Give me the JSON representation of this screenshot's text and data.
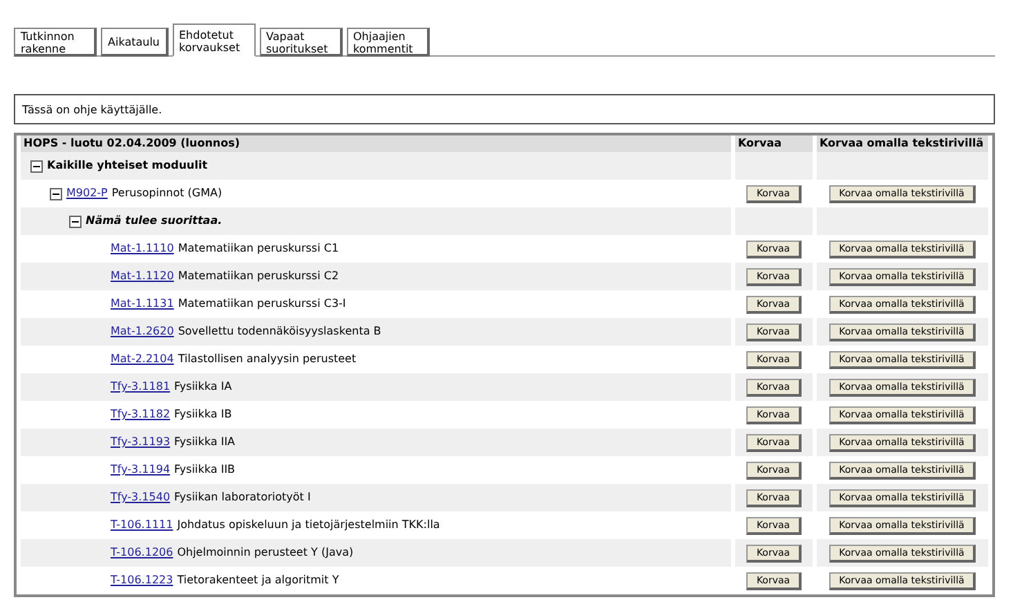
{
  "tabs": [
    {
      "label": "Tutkinnon rakenne",
      "selected": false
    },
    {
      "label": "Aikataulu",
      "selected": false
    },
    {
      "label": "Ehdotetut korvaukset",
      "selected": true
    },
    {
      "label": "Vapaat suoritukset",
      "selected": false
    },
    {
      "label": "Ohjaajien kommentit",
      "selected": false
    }
  ],
  "instructions": "Tässä on ohje käyttäjälle.",
  "table": {
    "columns": [
      "HOPS - luotu 02.04.2009 (luonnos)",
      "Korvaa",
      "Korvaa omalla tekstirivillä"
    ],
    "tree": [
      {
        "kind": "group",
        "name": "Kaikille yhteiset moduulit",
        "expanded": true,
        "children": [
          {
            "kind": "module",
            "code": "M902-P",
            "name": "Perusopinnot (GMA)",
            "expanded": true,
            "replace": "Korvaa",
            "replace_text": "Korvaa omalla tekstirivillä",
            "children": [
              {
                "kind": "subgroup",
                "name": "Nämä tulee suorittaa.",
                "expanded": true,
                "children": [
                  {
                    "kind": "course",
                    "code": "Mat-1.1110",
                    "name": "Matematiikan peruskurssi C1",
                    "replace": "Korvaa",
                    "replace_text": "Korvaa omalla tekstirivillä"
                  },
                  {
                    "kind": "course",
                    "code": "Mat-1.1120",
                    "name": "Matematiikan peruskurssi C2",
                    "replace": "Korvaa",
                    "replace_text": "Korvaa omalla tekstirivillä"
                  },
                  {
                    "kind": "course",
                    "code": "Mat-1.1131",
                    "name": "Matematiikan peruskurssi C3-I",
                    "replace": "Korvaa",
                    "replace_text": "Korvaa omalla tekstirivillä"
                  },
                  {
                    "kind": "course",
                    "code": "Mat-1.2620",
                    "name": "Sovellettu todennäköisyyslaskenta B",
                    "replace": "Korvaa",
                    "replace_text": "Korvaa omalla tekstirivillä"
                  },
                  {
                    "kind": "course",
                    "code": "Mat-2.2104",
                    "name": "Tilastollisen analyysin perusteet",
                    "replace": "Korvaa",
                    "replace_text": "Korvaa omalla tekstirivillä"
                  },
                  {
                    "kind": "course",
                    "code": "Tfy-3.1181",
                    "name": "Fysiikka IA",
                    "replace": "Korvaa",
                    "replace_text": "Korvaa omalla tekstirivillä"
                  },
                  {
                    "kind": "course",
                    "code": "Tfy-3.1182",
                    "name": "Fysiikka IB",
                    "replace": "Korvaa",
                    "replace_text": "Korvaa omalla tekstirivillä"
                  },
                  {
                    "kind": "course",
                    "code": "Tfy-3.1193",
                    "name": "Fysiikka IIA",
                    "replace": "Korvaa",
                    "replace_text": "Korvaa omalla tekstirivillä"
                  },
                  {
                    "kind": "course",
                    "code": "Tfy-3.1194",
                    "name": "Fysiikka IIB",
                    "replace": "Korvaa",
                    "replace_text": "Korvaa omalla tekstirivillä"
                  },
                  {
                    "kind": "course",
                    "code": "Tfy-3.1540",
                    "name": "Fysiikan laboratoriotyöt I",
                    "replace": "Korvaa",
                    "replace_text": "Korvaa omalla tekstirivillä"
                  },
                  {
                    "kind": "course",
                    "code": "T-106.1111",
                    "name": "Johdatus opiskeluun ja tietojärjestelmiin TKK:lla",
                    "replace": "Korvaa",
                    "replace_text": "Korvaa omalla tekstirivillä"
                  },
                  {
                    "kind": "course",
                    "code": "T-106.1206",
                    "name": "Ohjelmoinnin perusteet Y (Java)",
                    "replace": "Korvaa",
                    "replace_text": "Korvaa omalla tekstirivillä"
                  },
                  {
                    "kind": "course",
                    "code": "T-106.1223",
                    "name": "Tietorakenteet ja algoritmit Y",
                    "replace": "Korvaa",
                    "replace_text": "Korvaa omalla tekstirivillä"
                  }
                ]
              }
            ]
          }
        ]
      }
    ]
  }
}
